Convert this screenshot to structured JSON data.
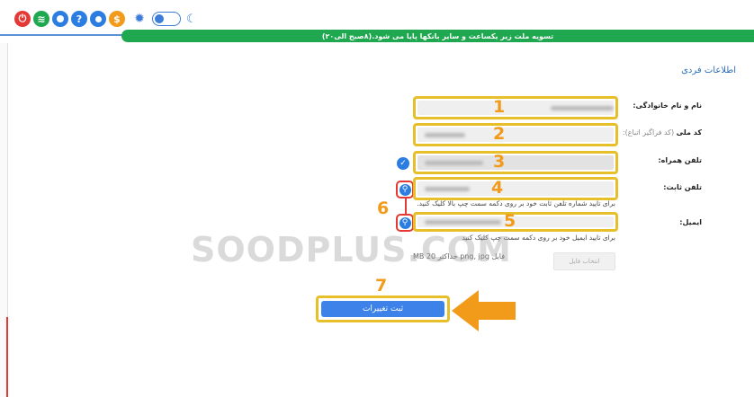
{
  "banner": {
    "text": "تسویه ملت زیر یکساعت و سایر بانکها پایا می شود.(۸صبح الی۲۰)"
  },
  "section_title": "اطلاعات فردی",
  "fields": [
    {
      "label": "نام و نام خانوادگی:",
      "hint": "",
      "number": "1"
    },
    {
      "label": "کد ملی",
      "hint": " (کد فراگیر اتباع):",
      "number": "2"
    },
    {
      "label": "تلفن همراه:",
      "hint": "",
      "number": "3"
    },
    {
      "label": "تلفن ثابت:",
      "hint": "",
      "number": "4"
    },
    {
      "label": "ایمیل:",
      "hint": "",
      "number": "5"
    }
  ],
  "help": {
    "phone": "برای تایید شماره تلفن ثابت خود بر روی دکمه سمت چپ بالا کلیک کنید.",
    "email": "برای تایید ایمیل خود بر روی دکمه سمت چپ کلیک کنید"
  },
  "verify_annotation_number": "6",
  "file": {
    "info": "فایل png, jpg حداکثر MB 20",
    "button_label": "انتخاب فایل"
  },
  "submit": {
    "number": "7",
    "label": "ثبت تغییرات"
  },
  "watermark": "SOODPLUS.COM",
  "colors": {
    "banner": "#1fa84f",
    "accent": "#3d82e8",
    "highlight": "#e6bf2b",
    "annotation": "#f29a1a",
    "danger": "#e53935"
  },
  "top_icons": [
    {
      "name": "power-icon",
      "glyph": "⏻",
      "color": "#e53935"
    },
    {
      "name": "wifi-icon",
      "glyph": "≋",
      "color": "#1fa84f"
    },
    {
      "name": "notification-icon",
      "glyph": "●",
      "color": "#2b7de1"
    },
    {
      "name": "help-icon",
      "glyph": "?",
      "color": "#2b7de1"
    },
    {
      "name": "user-icon",
      "glyph": "●",
      "color": "#2b7de1"
    },
    {
      "name": "wallet-icon",
      "glyph": "$",
      "color": "#f29a1a"
    }
  ]
}
